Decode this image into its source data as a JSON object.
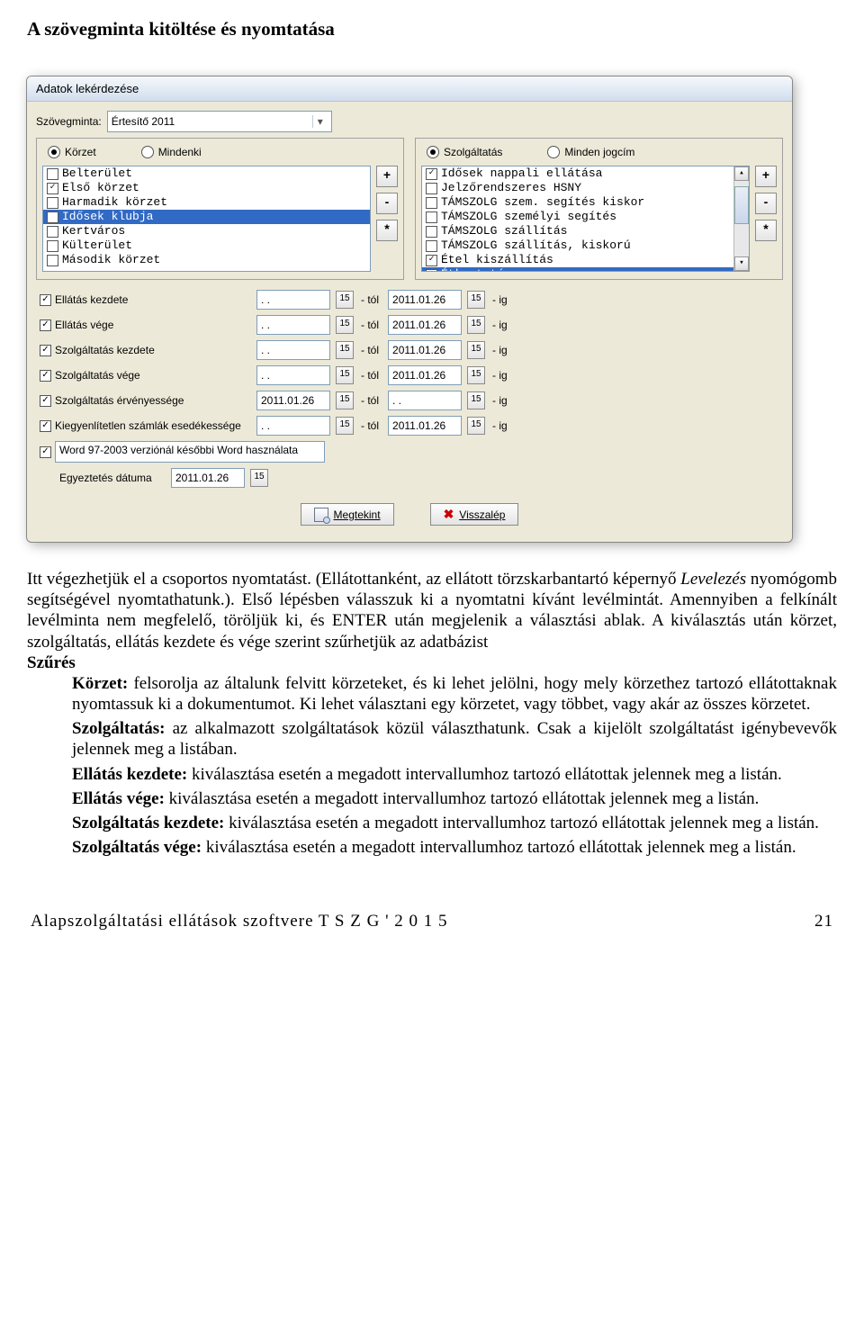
{
  "heading": "A szövegminta kitöltése és nyomtatása",
  "dialog": {
    "title": "Adatok lekérdezése",
    "szovegminta_label": "Szövegminta:",
    "szovegminta_value": "Értesítő 2011",
    "left": {
      "radio1": "Körzet",
      "radio2": "Mindenki",
      "items": [
        {
          "label": "Belterület",
          "checked": false,
          "sel": false
        },
        {
          "label": "Első körzet",
          "checked": true,
          "sel": false
        },
        {
          "label": "Harmadik körzet",
          "checked": false,
          "sel": false
        },
        {
          "label": "Idősek klubja",
          "checked": true,
          "sel": true
        },
        {
          "label": "Kertváros",
          "checked": false,
          "sel": false
        },
        {
          "label": "Külterület",
          "checked": false,
          "sel": false
        },
        {
          "label": "Második körzet",
          "checked": false,
          "sel": false
        }
      ]
    },
    "right": {
      "radio1": "Szolgáltatás",
      "radio2": "Minden jogcím",
      "items": [
        {
          "label": "Idősek nappali ellátása",
          "checked": true,
          "sel": false
        },
        {
          "label": "Jelzőrendszeres HSNY",
          "checked": false,
          "sel": false
        },
        {
          "label": "TÁMSZOLG szem. segítés kiskor",
          "checked": false,
          "sel": false
        },
        {
          "label": "TÁMSZOLG személyi segítés",
          "checked": false,
          "sel": false
        },
        {
          "label": "TÁMSZOLG szállítás",
          "checked": false,
          "sel": false
        },
        {
          "label": "TÁMSZOLG szállítás, kiskorú",
          "checked": false,
          "sel": false
        },
        {
          "label": "Étel kiszállítás",
          "checked": true,
          "sel": false
        },
        {
          "label": "Étkeztetés",
          "checked": true,
          "sel": true
        }
      ]
    },
    "btn_plus": "+",
    "btn_minus": "-",
    "btn_star": "*",
    "cal_glyph": "15",
    "tol": "- tól",
    "ig": "- ig",
    "filters": [
      {
        "label": "Ellátás kezdete",
        "from": ". .",
        "to": "2011.01.26"
      },
      {
        "label": "Ellátás vége",
        "from": ". .",
        "to": "2011.01.26"
      },
      {
        "label": "Szolgáltatás kezdete",
        "from": ". .",
        "to": "2011.01.26"
      },
      {
        "label": "Szolgáltatás vége",
        "from": ". .",
        "to": "2011.01.26"
      },
      {
        "label": "Szolgáltatás érvényessége",
        "from": "2011.01.26",
        "to": ". ."
      },
      {
        "label": "Kiegyenlítetlen számlák esedékessége",
        "from": ". .",
        "to": "2011.01.26"
      }
    ],
    "word_check_label": "Word 97-2003 verziónál későbbi Word használata",
    "egyeztet_label": "Egyeztetés dátuma",
    "egyeztet_value": "2011.01.26",
    "btn_megtekint": "Megtekint",
    "btn_visszalep": "Visszalép"
  },
  "para1": "Itt végezhetjük el a csoportos nyomtatást. (Ellátottanként, az ellátott törzskarbantartó képernyő ",
  "para1_italic": "Levelezés",
  "para1b": " nyomógomb segítségével nyomtathatunk.). Első lépésben válasszuk ki a nyomtatni kívánt levélmintát. Amennyiben a felkínált levélminta nem megfelelő, töröljük ki, és ENTER után megjelenik a választási ablak. A kiválasztás után körzet, szolgáltatás, ellátás kezdete és vége szerint szűrhetjük az adatbázist",
  "szures_label": "Szűrés",
  "korzet_head": "Körzet:",
  "korzet_body": " felsorolja az általunk felvitt körzeteket, és ki lehet jelölni, hogy mely körzethez tartozó ellátottaknak nyomtassuk ki a dokumentumot. Ki lehet választani egy körzetet, vagy többet, vagy akár az összes körzetet.",
  "szolg_head": "Szolgáltatás:",
  "szolg_body": " az alkalmazott szolgáltatások közül választhatunk. Csak a kijelölt szolgáltatást igénybevevők jelennek meg a listában.",
  "ek_head": "Ellátás kezdete:",
  "ek_body": " kiválasztása esetén a megadott intervallumhoz tartozó ellátottak jelennek meg a listán.",
  "ev_head": "Ellátás vége:",
  "ev_body": " kiválasztása esetén a megadott intervallumhoz tartozó ellátottak jelennek meg a listán.",
  "sk_head": "Szolgáltatás kezdete:",
  "sk_body": " kiválasztása esetén a megadott intervallumhoz tartozó ellátottak jelennek meg a listán.",
  "sv_head": "Szolgáltatás vége:",
  "sv_body": " kiválasztása esetén a megadott intervallumhoz tartozó ellátottak jelennek meg a listán.",
  "footer_left": "Alapszolgáltatási ellátások szoftvere  T S Z G  ' 2 0 1 5",
  "footer_right": "21"
}
